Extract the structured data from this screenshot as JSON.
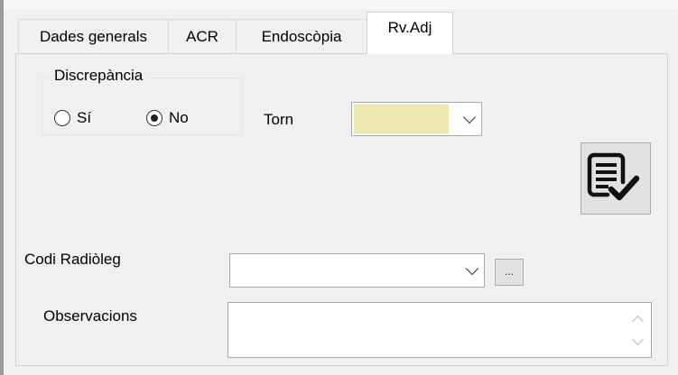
{
  "tabs": [
    {
      "label": "Dades generals"
    },
    {
      "label": "ACR"
    },
    {
      "label": "Endoscòpia"
    },
    {
      "label": "Rv.Adj",
      "active": true
    }
  ],
  "discrepancia": {
    "title": "Discrepància",
    "options": [
      {
        "label": "Sí",
        "checked": false
      },
      {
        "label": "No",
        "checked": true
      }
    ]
  },
  "torn": {
    "label": "Torn",
    "value": "",
    "fill_color": "#ece8b0"
  },
  "validate_button": {
    "icon": "document-check-icon"
  },
  "codi_radioleg": {
    "label": "Codi Radiòleg",
    "value": "",
    "browse_label": "..."
  },
  "observacions": {
    "label": "Observacions",
    "value": ""
  }
}
